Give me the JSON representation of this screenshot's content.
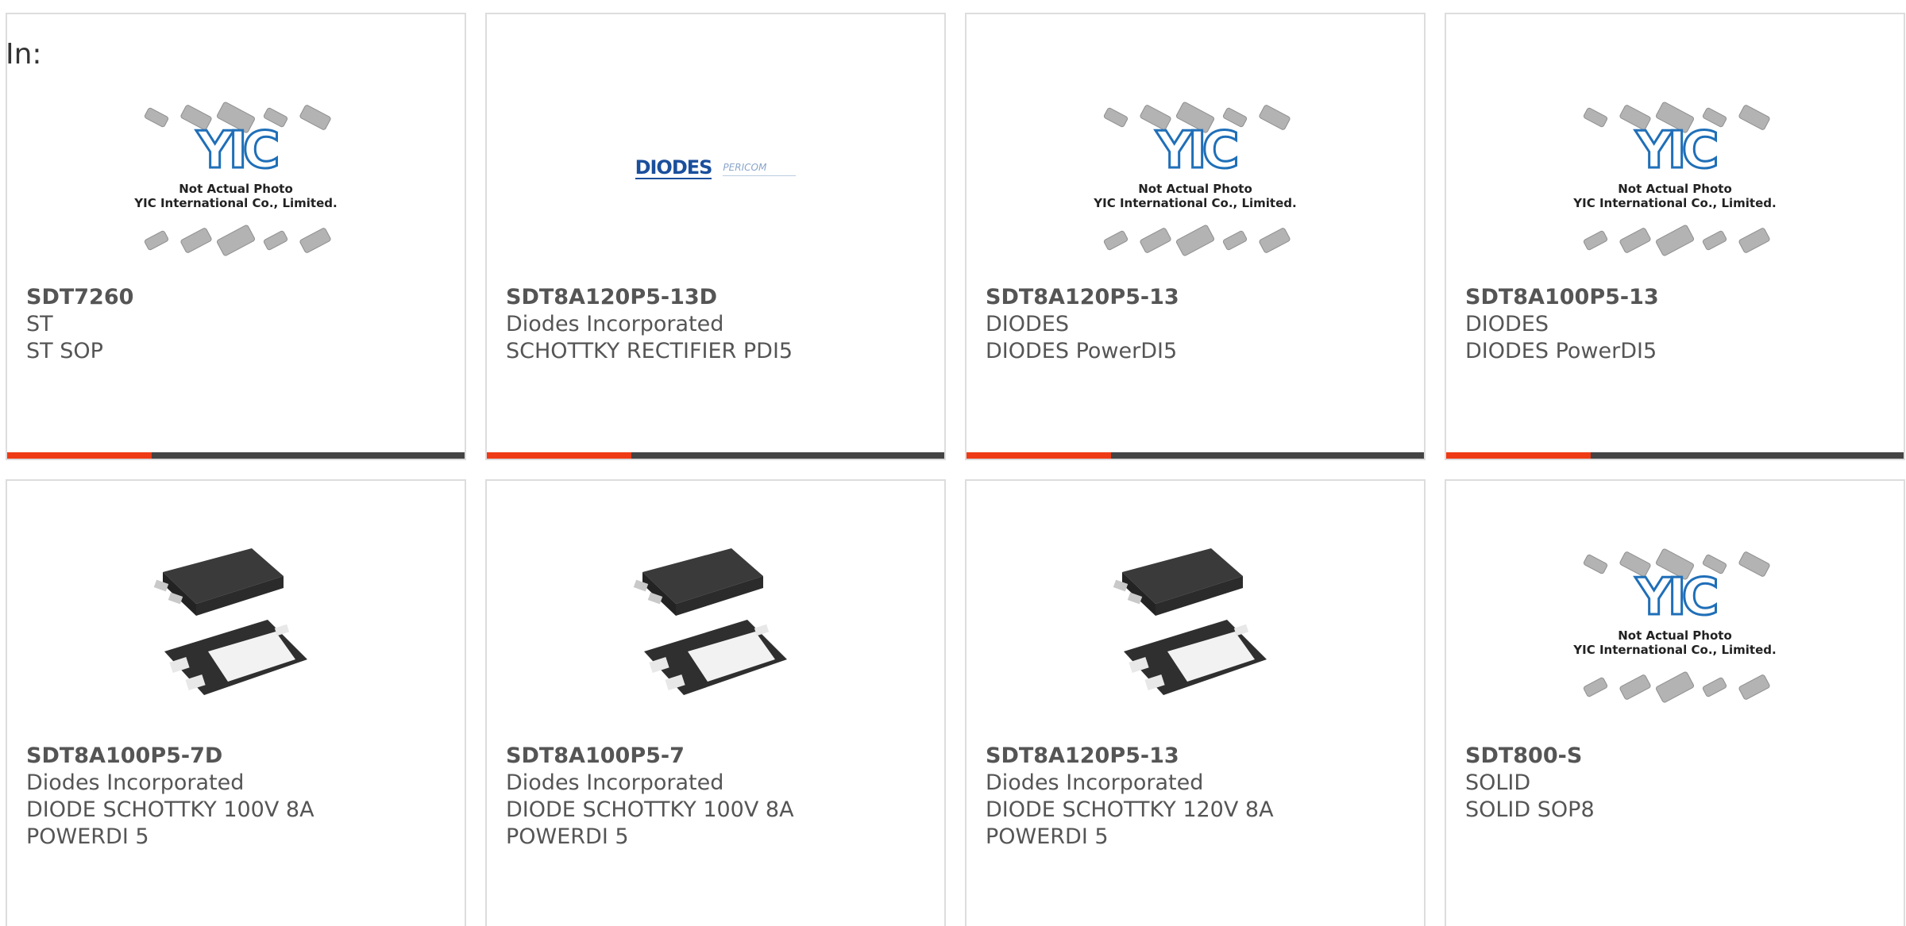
{
  "header": {
    "in_label": "In:"
  },
  "placeholder": {
    "brand": "YIC",
    "line1": "Not Actual Photo",
    "line2": "YIC International Co., Limited."
  },
  "logo": {
    "diodes_text": "DIODES",
    "pericom_text": "PERICOM"
  },
  "colors": {
    "accent": "#ee3b16",
    "bar": "#444444",
    "border": "#dddddd",
    "text": "#555555"
  },
  "products": [
    {
      "part": "SDT7260",
      "maker": "ST",
      "desc": "ST SOP",
      "desc2": "",
      "image": "yic-placeholder"
    },
    {
      "part": "SDT8A120P5-13D",
      "maker": "Diodes Incorporated",
      "desc": "SCHOTTKY RECTIFIER PDI5",
      "desc2": "",
      "image": "diodes-logo"
    },
    {
      "part": "SDT8A120P5-13",
      "maker": "DIODES",
      "desc": "DIODES PowerDI5",
      "desc2": "",
      "image": "yic-placeholder"
    },
    {
      "part": "SDT8A100P5-13",
      "maker": "DIODES",
      "desc": "DIODES PowerDI5",
      "desc2": "",
      "image": "yic-placeholder"
    },
    {
      "part": "SDT8A100P5-7D",
      "maker": "Diodes Incorporated",
      "desc": "DIODE SCHOTTKY 100V 8A",
      "desc2": "POWERDI 5",
      "image": "powerdi5-package"
    },
    {
      "part": "SDT8A100P5-7",
      "maker": "Diodes Incorporated",
      "desc": "DIODE SCHOTTKY 100V 8A",
      "desc2": "POWERDI 5",
      "image": "powerdi5-package"
    },
    {
      "part": "SDT8A120P5-13",
      "maker": "Diodes Incorporated",
      "desc": "DIODE SCHOTTKY 120V 8A",
      "desc2": "POWERDI 5",
      "image": "powerdi5-package"
    },
    {
      "part": "SDT800-S",
      "maker": "SOLID",
      "desc": "SOLID SOP8",
      "desc2": "",
      "image": "yic-placeholder"
    }
  ]
}
